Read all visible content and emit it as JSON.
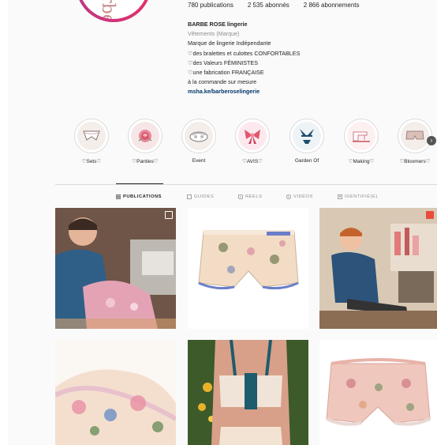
{
  "profile": {
    "avatar_text": "Barbe Rose",
    "stats": {
      "posts": "780 publications",
      "followers": "2 535 abonnés",
      "following": "2 866 abonnements"
    },
    "bio": {
      "name": "BARBE ROSE lingerie",
      "category": "Vêtements (Marque)",
      "lines": [
        "Marque de lingerie Indépendante",
        "♡des bralettes et culottes CONFORTABLES",
        "♡des Valeurs FÉMINISTES",
        "♡une fabrication FRANÇAISE",
        "à la commande sur mesure"
      ],
      "link": "msha.ke/barberoselingerie"
    }
  },
  "highlights": [
    {
      "label": "♡Sets♡",
      "icon": "underwear-sketch-icon"
    },
    {
      "label": "♡Panties♡",
      "icon": "rose-icon"
    },
    {
      "label": "Event",
      "icon": "event-icon"
    },
    {
      "label": "♡AVIS♡",
      "icon": "bow-icon"
    },
    {
      "label": "Garden Of",
      "icon": "bralette-icon"
    },
    {
      "label": "♡Making♡",
      "icon": "sewing-machine-icon"
    },
    {
      "label": "♡Bloomers♡",
      "icon": "bloomers-icon"
    }
  ],
  "tabs": [
    {
      "label": "PUBLICATIONS",
      "icon": "grid-icon",
      "active": true
    },
    {
      "label": "GUIDES",
      "icon": "guide-icon",
      "active": false
    },
    {
      "label": "REELS",
      "icon": "reels-icon",
      "active": false
    },
    {
      "label": "VIDÉOS",
      "icon": "video-icon",
      "active": false
    },
    {
      "label": "IDENTIFIÉ(E)",
      "icon": "tag-icon",
      "active": false
    }
  ],
  "posts": [
    {
      "subject": "woman sewing",
      "badge": "carousel"
    },
    {
      "subject": "floral bloomers",
      "badge": "none"
    },
    {
      "subject": "woman in atelier",
      "badge": "reel"
    },
    {
      "subject": "floral ruffle panty",
      "badge": "none"
    },
    {
      "subject": "bralette back",
      "badge": "none"
    },
    {
      "subject": "pink floral bloomers",
      "badge": "none"
    }
  ]
}
